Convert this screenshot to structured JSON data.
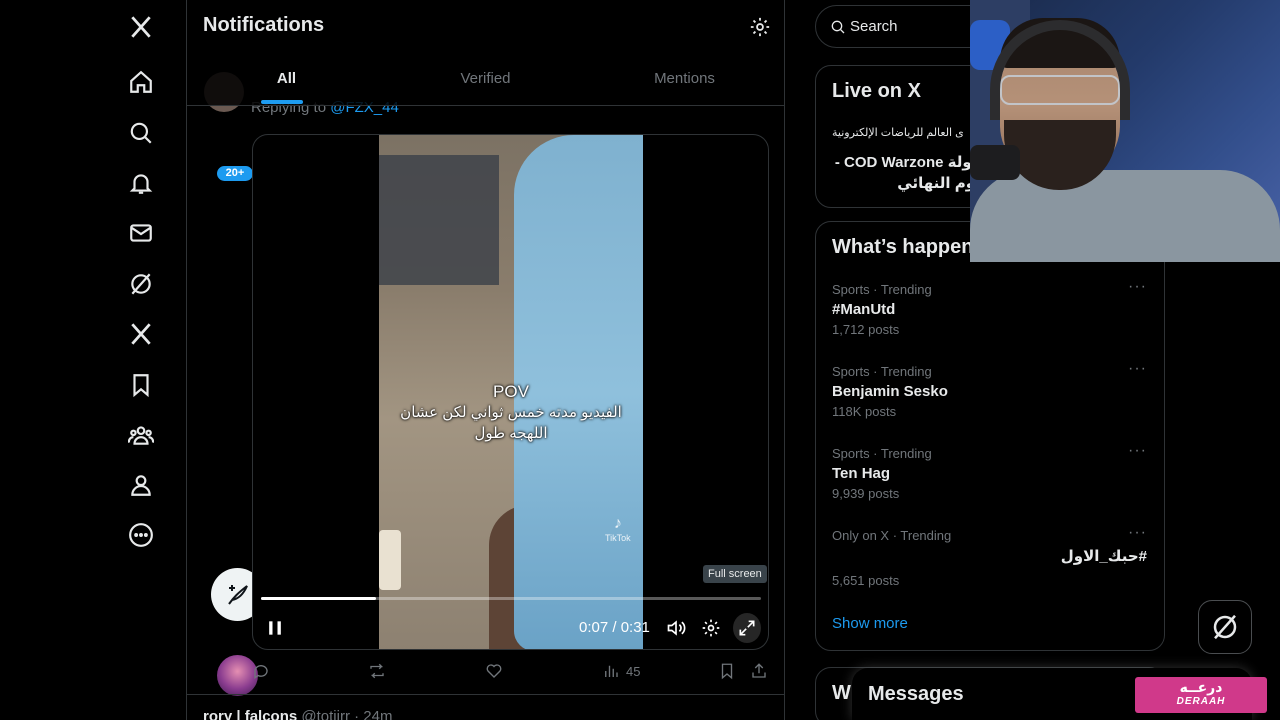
{
  "header": {
    "title": "Notifications"
  },
  "tabs": [
    {
      "label": "All"
    },
    {
      "label": "Verified"
    },
    {
      "label": "Mentions"
    }
  ],
  "nav": {
    "badge": "20+"
  },
  "post": {
    "replying_prefix": "Replying to ",
    "replying_handle": "@FZX_44",
    "video": {
      "overlay_title": "POV",
      "overlay_line1": "الفيديو مدته خمس ثواني لكن عشان",
      "overlay_line2": "اللهجه طول",
      "watermark": "TikTok",
      "tooltip": "Full screen",
      "time": "0:07 / 0:31",
      "progress": 0.23
    },
    "views": "45"
  },
  "next_post": {
    "name": "rory | falcons",
    "handle": "@totiirr",
    "age": "· 24m"
  },
  "search": {
    "placeholder": "Search"
  },
  "live": {
    "title": "Live on X",
    "host": "ى العالم للرياضات الإلكترونية",
    "stream_title": "بطولة COD Warzone - اليوم النهائي"
  },
  "trends": {
    "title": "What’s happening",
    "items": [
      {
        "meta": "Sports · Trending",
        "name": "#ManUtd",
        "posts": "1,712 posts"
      },
      {
        "meta": "Sports · Trending",
        "name": "Benjamin Sesko",
        "posts": "118K posts"
      },
      {
        "meta": "Sports · Trending",
        "name": "Ten Hag",
        "posts": "9,939 posts"
      },
      {
        "meta": "Only on X · Trending",
        "name": "#حبك_الاول",
        "posts": "5,651 posts"
      }
    ],
    "show_more": "Show more"
  },
  "partial_card_title": "W",
  "messages": {
    "title": "Messages"
  },
  "deraah": {
    "ar": "درعــه",
    "en": "DERAAH"
  },
  "colors": {
    "accent": "#1d9bf0",
    "background": "#000000",
    "border": "#2f3336",
    "muted": "#71767b",
    "deraah": "#d0398a"
  },
  "icons": {
    "nav": [
      "x-logo-icon",
      "home-icon",
      "search-icon",
      "notifications-icon",
      "messages-icon",
      "grok-icon",
      "x-premium-icon",
      "bookmarks-icon",
      "communities-icon",
      "profile-icon",
      "more-icon"
    ]
  }
}
